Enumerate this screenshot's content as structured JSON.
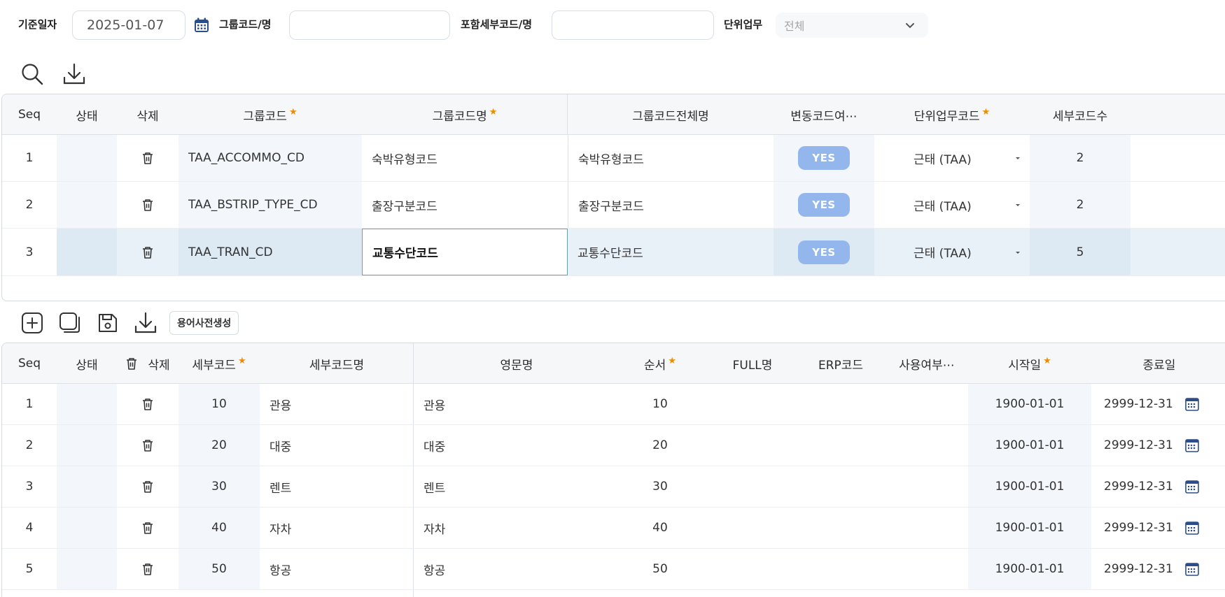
{
  "search": {
    "base_date_label": "기준일자",
    "base_date_value": "2025-01-07",
    "group_code_label": "그룹코드/명",
    "group_code_value": "",
    "sub_code_label": "포함세부코드/명",
    "sub_code_value": "",
    "unit_task_label": "단위업무",
    "unit_task_value": "전체"
  },
  "group_grid": {
    "columns": [
      "Seq",
      "상태",
      "삭제",
      "그룹코드",
      "그룹코드명",
      "그룹코드전체명",
      "변동코드여⋯",
      "단위업무코드",
      "세부코드수"
    ],
    "rows": [
      {
        "seq": "1",
        "status": "",
        "code": "TAA_ACCOMMO_CD",
        "name": "숙박유형코드",
        "full_name": "숙박유형코드",
        "variable": "YES",
        "unit": "근태 (TAA)",
        "count": "2"
      },
      {
        "seq": "2",
        "status": "",
        "code": "TAA_BSTRIP_TYPE_CD",
        "name": "출장구분코드",
        "full_name": "출장구분코드",
        "variable": "YES",
        "unit": "근태 (TAA)",
        "count": "2"
      },
      {
        "seq": "3",
        "status": "",
        "code": "TAA_TRAN_CD",
        "name": "교통수단코드",
        "full_name": "교통수단코드",
        "variable": "YES",
        "unit": "근태 (TAA)",
        "count": "5"
      }
    ]
  },
  "detail_toolbar": {
    "dictionary_button": "용어사전생성"
  },
  "detail_grid": {
    "columns": [
      "Seq",
      "상태",
      "삭제",
      "세부코드",
      "세부코드명",
      "영문명",
      "순서",
      "FULL명",
      "ERP코드",
      "사용여부⋯",
      "시작일",
      "종료일"
    ],
    "rows": [
      {
        "seq": "1",
        "code": "10",
        "name": "관용",
        "eng": "관용",
        "order": "10",
        "start": "1900-01-01",
        "end": "2999-12-31"
      },
      {
        "seq": "2",
        "code": "20",
        "name": "대중",
        "eng": "대중",
        "order": "20",
        "start": "1900-01-01",
        "end": "2999-12-31"
      },
      {
        "seq": "3",
        "code": "30",
        "name": "렌트",
        "eng": "렌트",
        "order": "30",
        "start": "1900-01-01",
        "end": "2999-12-31"
      },
      {
        "seq": "4",
        "code": "40",
        "name": "자차",
        "eng": "자차",
        "order": "40",
        "start": "1900-01-01",
        "end": "2999-12-31"
      },
      {
        "seq": "5",
        "code": "50",
        "name": "항공",
        "eng": "항공",
        "order": "50",
        "start": "1900-01-01",
        "end": "2999-12-31"
      }
    ]
  },
  "colors": {
    "accent_star": "#f08a00",
    "yes_badge": "#93b7ec",
    "selected_row": "#e8f1f8",
    "edit_border": "#6aa3a6"
  },
  "icons": [
    "calendar-icon",
    "chevron-down-icon",
    "search-icon",
    "download-icon",
    "add-icon",
    "copy-icon",
    "save-icon",
    "trash-icon",
    "dropdown-caret-icon"
  ]
}
